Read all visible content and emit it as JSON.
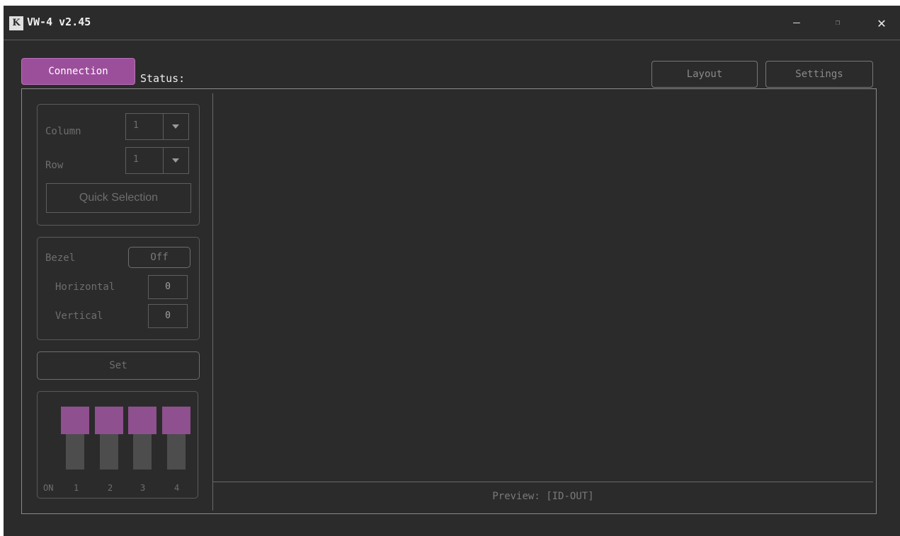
{
  "window": {
    "logo": "K",
    "title": "VW-4 v2.45",
    "controls": {
      "minimize": "–",
      "maximize": "❐",
      "close": "✕"
    }
  },
  "toolbar": {
    "connection_label": "Connection",
    "status_label": "Status:",
    "layout_label": "Layout",
    "settings_label": "Settings"
  },
  "grid": {
    "column_label": "Column",
    "column_value": "1",
    "row_label": "Row",
    "row_value": "1",
    "quick_selection_label": "Quick Selection"
  },
  "bezel": {
    "label": "Bezel",
    "toggle_value": "Off",
    "horizontal_label": "Horizontal",
    "horizontal_value": "0",
    "vertical_label": "Vertical",
    "vertical_value": "0"
  },
  "set_label": "Set",
  "dip_switch": {
    "on_label": "ON",
    "switches": [
      "1",
      "2",
      "3",
      "4"
    ],
    "knob_color": "#8f508f"
  },
  "preview": {
    "label": "Preview: [ID-OUT]"
  },
  "colors": {
    "accent": "#9b4f9b",
    "background": "#2b2b2b"
  }
}
